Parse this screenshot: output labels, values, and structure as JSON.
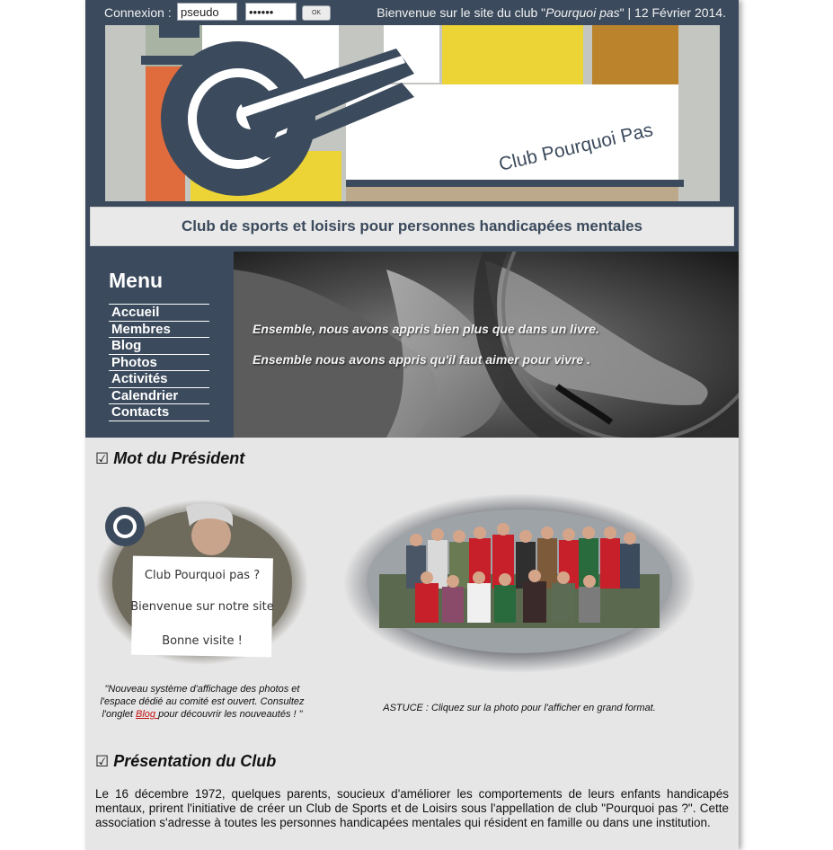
{
  "login": {
    "label": "Connexion :",
    "pseudo_value": "pseudo",
    "password_value": "••••••",
    "ok_label": "OK"
  },
  "welcome": {
    "prefix": "Bienvenue sur le site du club \"",
    "club_name": "Pourquoi pas",
    "suffix": "\"  |  12 Février 2014."
  },
  "banner": {
    "logo_text": "Club Pourquoi Pas",
    "colors": {
      "navy": "#3b4a5c",
      "yellow": "#ecd437",
      "ochre": "#bb842c",
      "orange": "#e06b3c",
      "sage": "#a9b3a4",
      "gray": "#c3c6c1",
      "white": "#ffffff",
      "sand": "#bca98b"
    }
  },
  "tagline": "Club de sports et loisirs pour personnes handicapées mentales",
  "menu": {
    "title": "Menu",
    "items": [
      "Accueil",
      "Membres",
      "Blog",
      "Photos",
      "Activités",
      "Calendrier",
      "Contacts"
    ]
  },
  "hero": {
    "quote_1": "Ensemble, nous avons appris bien plus que dans un livre.",
    "quote_2": "Ensemble nous avons appris qu'il faut aimer pour vivre ."
  },
  "president": {
    "heading": "Mot du Président",
    "checkbox_glyph": "☑",
    "sign_lines": [
      "Club Pourquoi pas ?",
      "Bienvenue sur notre site",
      "Bonne visite !"
    ],
    "caption_before_link": "\"Nouveau système d'affichage des photos et l'espace dédié au comité est ouvert. Consultez l'onglet ",
    "caption_link": "Blog ",
    "caption_after_link": "pour découvrir les nouveautés ! \"",
    "tip": "ASTUCE : Cliquez sur la photo pour l'afficher en grand format."
  },
  "club": {
    "heading": "Présentation du Club",
    "checkbox_glyph": "☑",
    "paragraph": "Le 16 décembre 1972, quelques parents, soucieux d'améliorer les comportements de leurs enfants handicapés mentaux, prirent l'initiative de créer un Club de Sports et de Loisirs sous l'appellation de club \"Pourquoi pas ?\". Cette association s'adresse à toutes les personnes handicapées mentales qui résident en famille ou dans une institution."
  }
}
